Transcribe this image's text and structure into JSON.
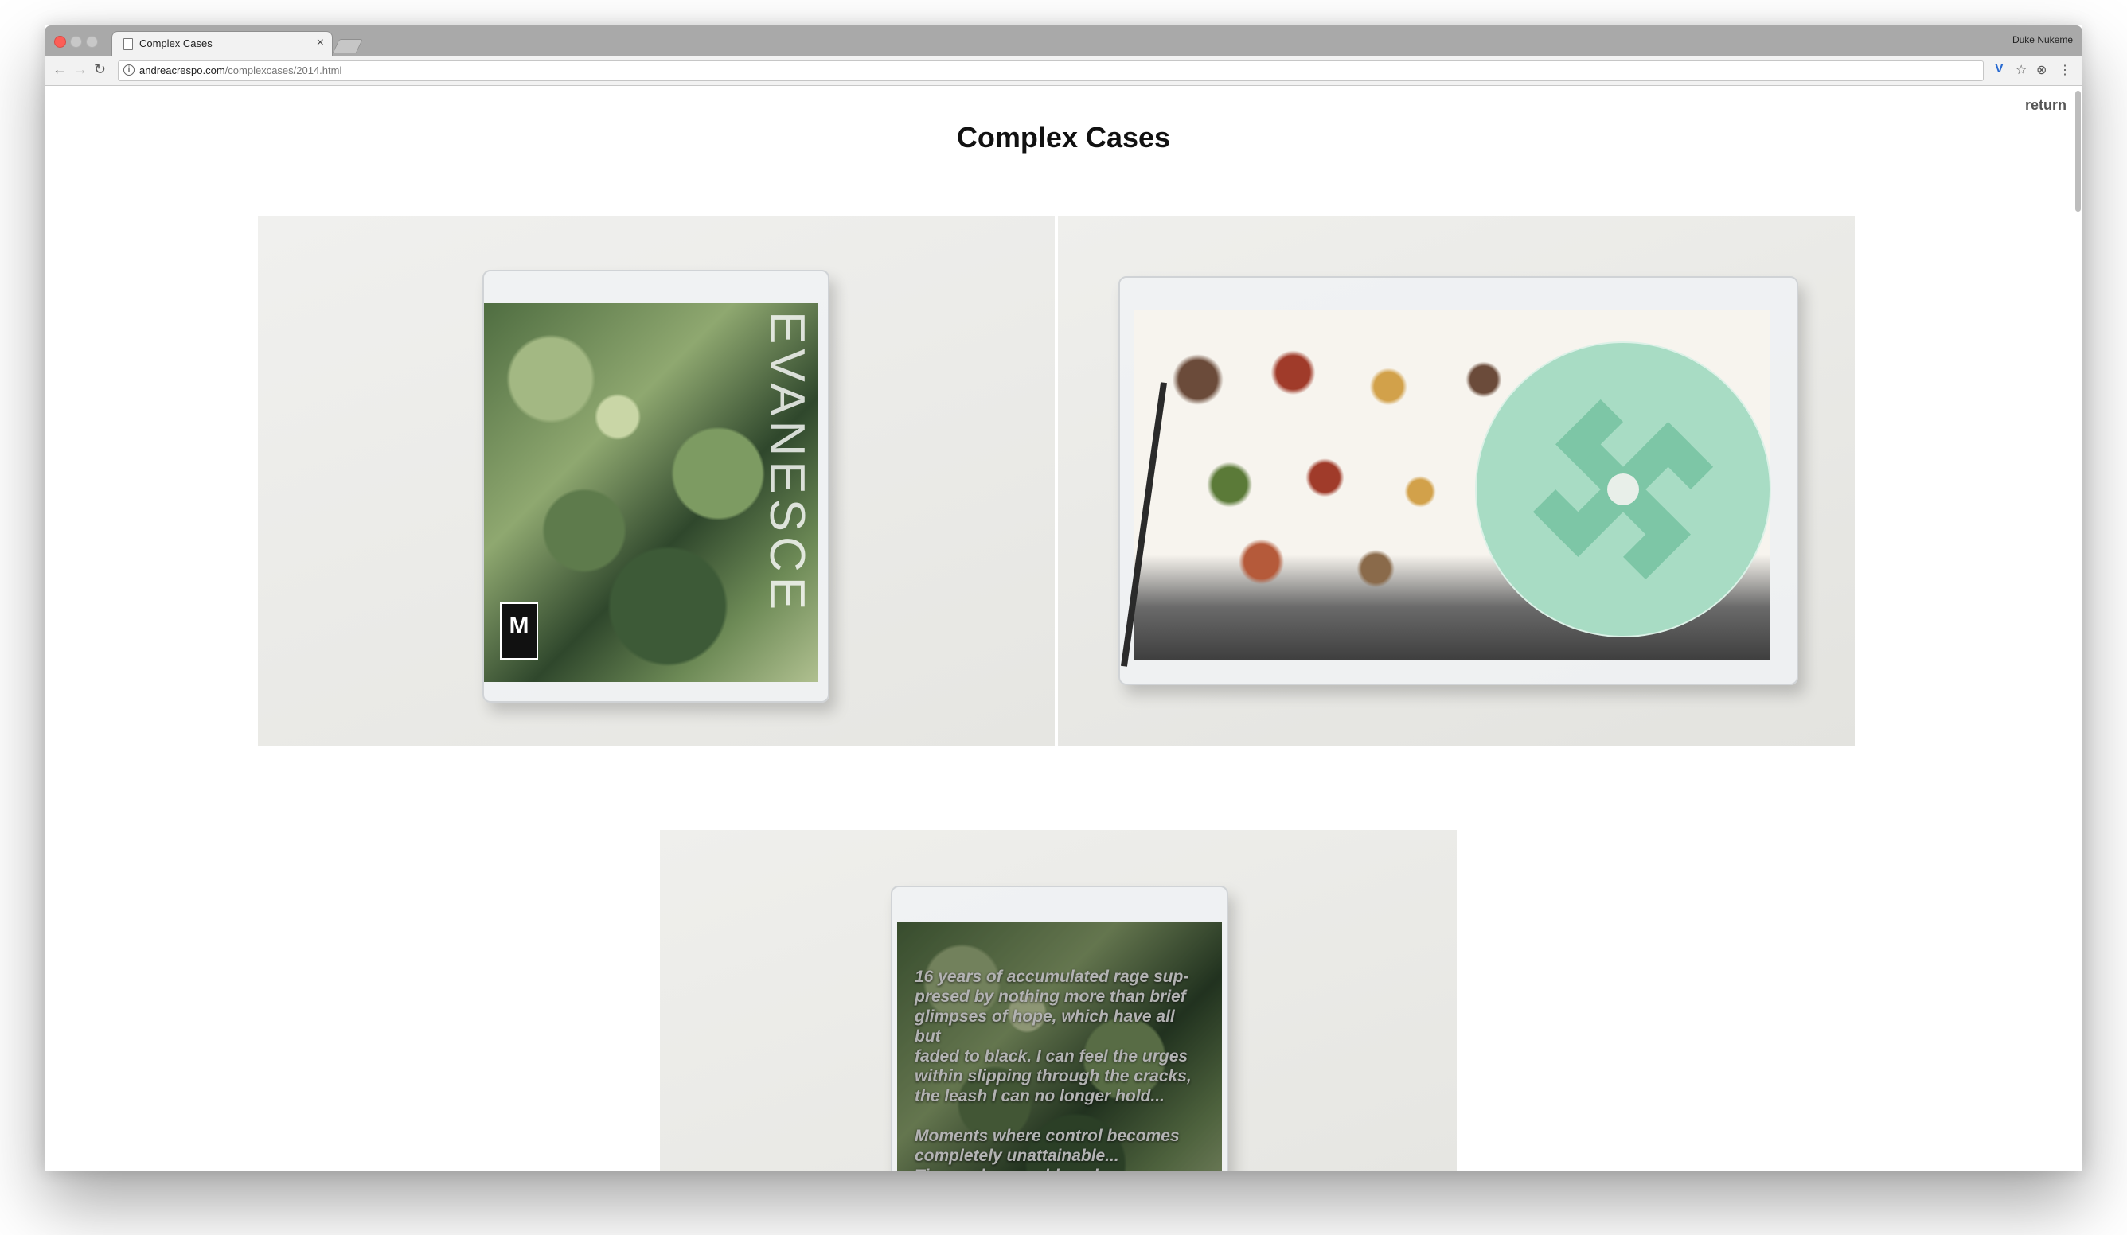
{
  "browser": {
    "tab_title": "Complex Cases",
    "tab_close": "×",
    "profile_name": "Duke Nukeme",
    "url_host": "andreacrespo.com",
    "url_path": "/complexcases/2014.html",
    "nav_back": "←",
    "nav_forward": "→",
    "nav_reload": "↻",
    "info_icon": "i",
    "ext_icon": "V",
    "star_icon": "☆",
    "ext2_icon": "⊗",
    "menu_icon": "⋮"
  },
  "page": {
    "title": "Complex Cases",
    "return_label": "return"
  },
  "photos": {
    "cover": {
      "rating": "M",
      "cover_text": "EVANESCE"
    },
    "back": {
      "text": "16 years of accumulated rage sup-\npresed by nothing more than brief\nglimpses of hope, which have all but\nfaded to black. I can feel the urges\nwithin slipping through the cracks,\nthe leash I can no longer hold...\n\nMoments where control becomes\ncompletely unattainable...\nTimes when maddened psychopaths\nbriefly open the gates to hell, and let\nchaos flood through...\nThose few individuals who care"
    }
  },
  "colors": {
    "accent_close": "#fc5e57",
    "disc": "#a8dcc4",
    "title_text": "#111111"
  }
}
